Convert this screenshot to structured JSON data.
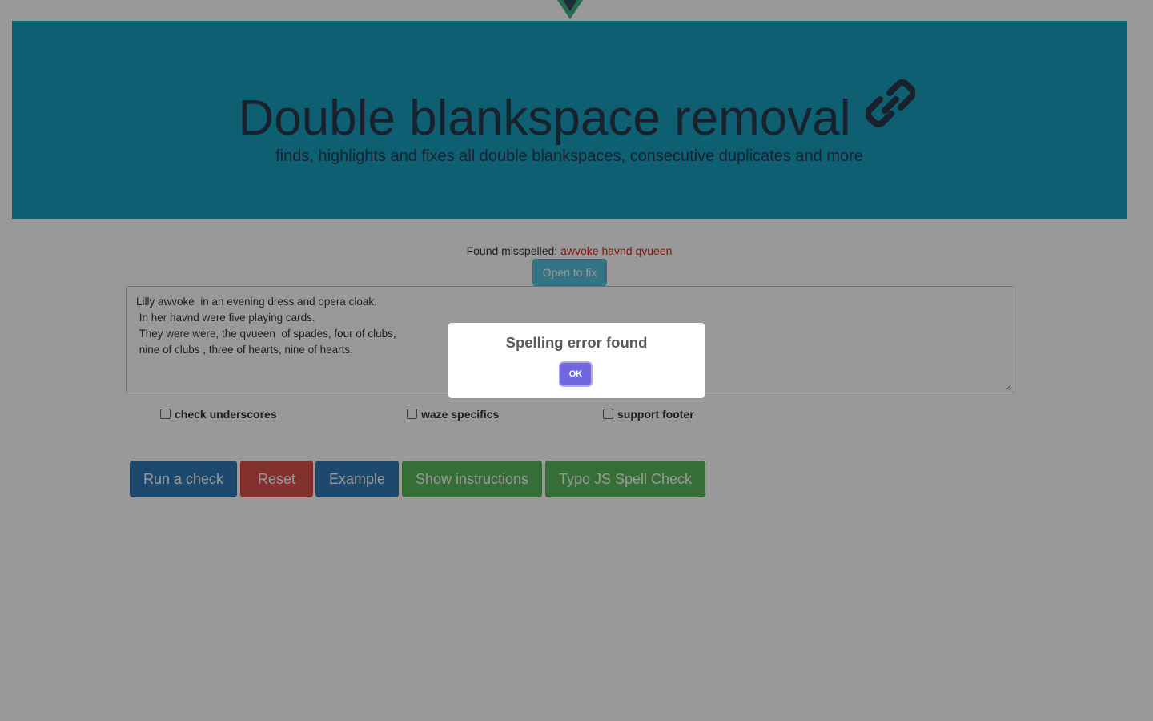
{
  "header": {
    "title": "Double blankspace removal",
    "subtitle": "finds, highlights and fixes all double blankspaces, consecutive duplicates and more"
  },
  "status": {
    "found_label": "Found misspelled:",
    "found_words": "awvoke havnd qvueen"
  },
  "open_fix_label": "Open to fix",
  "editor": {
    "lines": [
      "Lilly awvoke  in an evening dress and opera cloak.",
      " In her havnd were five playing cards.",
      " They were were, the qvueen  of spades, four of clubs,",
      " nine of clubs , three of hearts, nine of hearts."
    ]
  },
  "options": [
    {
      "label": "check underscores",
      "checked": false
    },
    {
      "label": "waze specifics",
      "checked": false
    },
    {
      "label": "support footer",
      "checked": false
    }
  ],
  "actions": {
    "run": "Run a check",
    "reset": "Reset",
    "example": "Example",
    "instructions": "Show instructions",
    "typo": "Typo JS Spell Check"
  },
  "dialog": {
    "title": "Spelling error found",
    "ok": "OK"
  },
  "colors": {
    "hero": "#1a9fc0",
    "misspelled": "#d9201a",
    "ok_button": "#7066e0"
  }
}
